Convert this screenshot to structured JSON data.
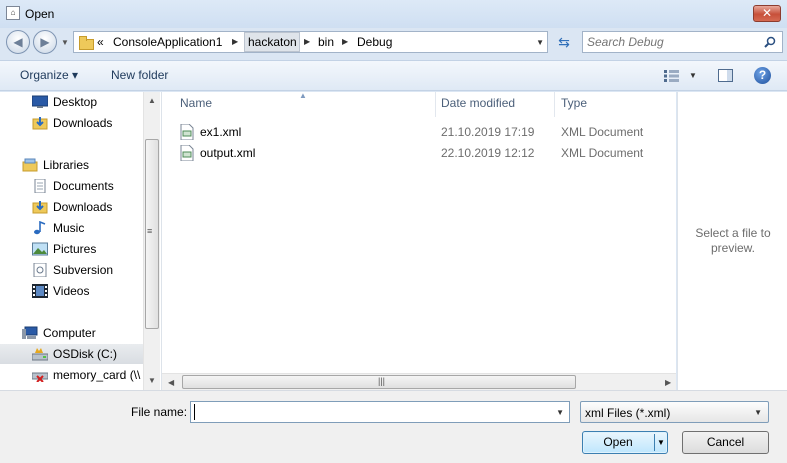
{
  "window": {
    "title": "Open",
    "close_label": "✕"
  },
  "address": {
    "crumbs": [
      "ConsoleApplication1",
      "hackaton",
      "bin",
      "Debug"
    ],
    "overflow_marker": "«"
  },
  "search": {
    "placeholder": "Search Debug",
    "value": ""
  },
  "toolbar": {
    "organize_label": "Organize ▾",
    "new_folder_label": "New folder"
  },
  "nav": {
    "items": [
      {
        "label": "Desktop",
        "icon": "desktop-icon"
      },
      {
        "label": "Downloads",
        "icon": "downloads-icon"
      },
      {
        "label": "Libraries",
        "icon": "libraries-icon"
      },
      {
        "label": "Documents",
        "icon": "documents-icon"
      },
      {
        "label": "Downloads",
        "icon": "downloads-icon"
      },
      {
        "label": "Music",
        "icon": "music-icon"
      },
      {
        "label": "Pictures",
        "icon": "pictures-icon"
      },
      {
        "label": "Subversion",
        "icon": "subversion-icon"
      },
      {
        "label": "Videos",
        "icon": "videos-icon"
      },
      {
        "label": "Computer",
        "icon": "computer-icon"
      },
      {
        "label": "OSDisk (C:)",
        "icon": "disk-icon",
        "selected": true
      },
      {
        "label": "memory_card (\\\\",
        "icon": "network-drive-icon"
      }
    ]
  },
  "columns": {
    "name": "Name",
    "date": "Date modified",
    "type": "Type"
  },
  "files": [
    {
      "name": "ex1.xml",
      "date": "21.10.2019 17:19",
      "type": "XML Document",
      "icon": "xml-file-icon"
    },
    {
      "name": "output.xml",
      "date": "22.10.2019 12:12",
      "type": "XML Document",
      "icon": "xml-file-icon"
    }
  ],
  "preview": {
    "line1": "Select a file to",
    "line2": "preview."
  },
  "bottom": {
    "file_name_label": "File name:",
    "file_name_value": "",
    "file_type_selected": "xml Files (*.xml)",
    "open_label": "Open",
    "cancel_label": "Cancel"
  },
  "colors": {
    "accent": "#3c7fb1",
    "chrome": "#dbe6f3",
    "close": "#c7503a"
  }
}
